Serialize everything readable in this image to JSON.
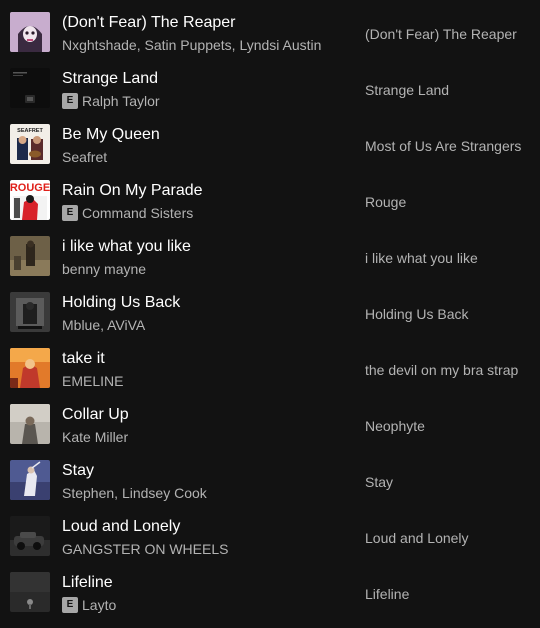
{
  "tracks": [
    {
      "title": "(Don't Fear) The Reaper",
      "artists": "Nxghtshade, Satin Puppets, Lyndsi Austin",
      "explicit": false,
      "album": "(Don't Fear) The Reaper"
    },
    {
      "title": "Strange Land",
      "artists": "Ralph Taylor",
      "explicit": true,
      "album": "Strange Land"
    },
    {
      "title": "Be My Queen",
      "artists": "Seafret",
      "explicit": false,
      "album": "Most of Us Are Strangers"
    },
    {
      "title": "Rain On My Parade",
      "artists": "Command Sisters",
      "explicit": true,
      "album": "Rouge"
    },
    {
      "title": "i like what you like",
      "artists": "benny mayne",
      "explicit": false,
      "album": "i like what you like"
    },
    {
      "title": "Holding Us Back",
      "artists": "Mblue, AViVA",
      "explicit": false,
      "album": "Holding Us Back"
    },
    {
      "title": "take it",
      "artists": "EMELINE",
      "explicit": false,
      "album": "the devil on my bra strap"
    },
    {
      "title": "Collar Up",
      "artists": "Kate Miller",
      "explicit": false,
      "album": "Neophyte"
    },
    {
      "title": "Stay",
      "artists": "Stephen, Lindsey Cook",
      "explicit": false,
      "album": "Stay"
    },
    {
      "title": "Loud and Lonely",
      "artists": "GANGSTER ON WHEELS",
      "explicit": false,
      "album": "Loud and Lonely"
    },
    {
      "title": "Lifeline",
      "artists": "Layto",
      "explicit": true,
      "album": "Lifeline"
    }
  ],
  "explicit_label": "E",
  "cover_text": {
    "seafret": "SEAFRET",
    "rouge": "ROUGE"
  }
}
